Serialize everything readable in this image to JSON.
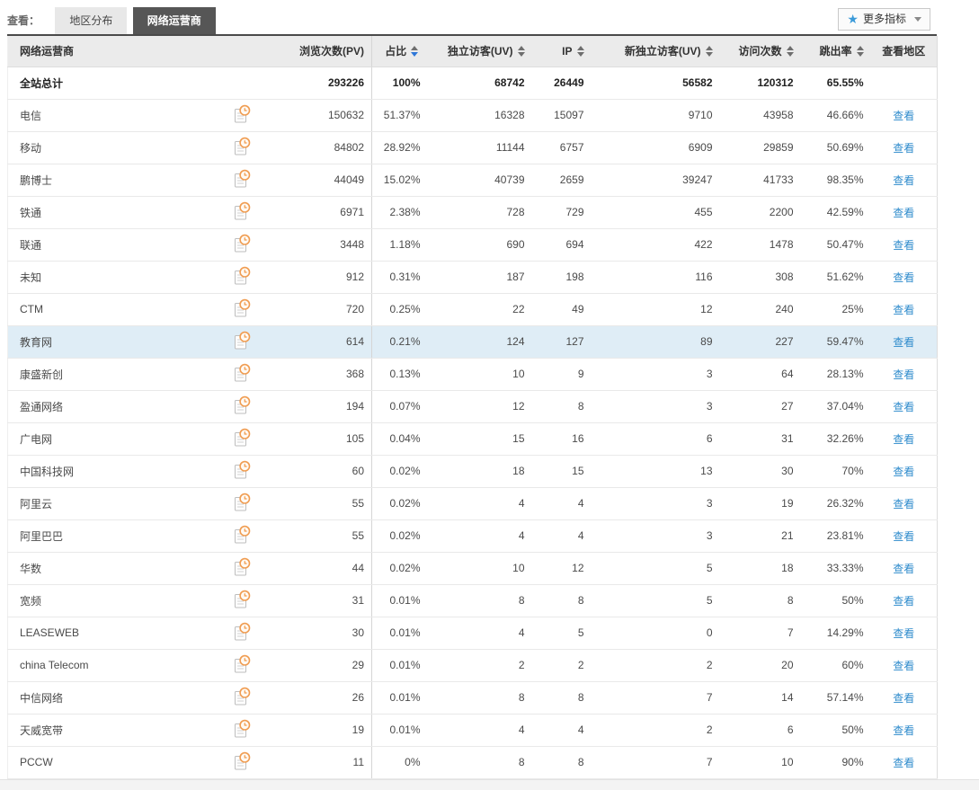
{
  "toolbar": {
    "view_label": "查看：",
    "tabs": [
      {
        "label": "地区分布",
        "active": false
      },
      {
        "label": "网络运营商",
        "active": true
      }
    ],
    "more_metrics": {
      "label": "更多指标",
      "icon": "star-icon",
      "caret_icon": "caret-down-icon"
    }
  },
  "icons": {
    "row_icon": "trend-history-icon",
    "row_icon_color": "#f09d52"
  },
  "colors": {
    "accent_link": "#2e8bcc",
    "active_tab_bg": "#565656",
    "active_sort_arrow": "#2e77d8",
    "highlight_row_bg": "#dfedf6",
    "header_bg": "#ebebeb",
    "star_blue": "#3a9ad9"
  },
  "table": {
    "columns": [
      {
        "key": "name",
        "label": "网络运营商",
        "sortable": false
      },
      {
        "key": "icon",
        "label": "",
        "sortable": false
      },
      {
        "key": "pv",
        "label": "浏览次数(PV)",
        "sortable": false
      },
      {
        "key": "ratio",
        "label": "占比",
        "sortable": true,
        "sort": "desc"
      },
      {
        "key": "uv",
        "label": "独立访客(UV)",
        "sortable": true
      },
      {
        "key": "ip",
        "label": "IP",
        "sortable": true
      },
      {
        "key": "newuv",
        "label": "新独立访客(UV)",
        "sortable": true
      },
      {
        "key": "visits",
        "label": "访问次数",
        "sortable": true
      },
      {
        "key": "bounce",
        "label": "跳出率",
        "sortable": true
      },
      {
        "key": "view",
        "label": "查看地区",
        "sortable": false
      }
    ],
    "view_link_label": "查看",
    "total_row": {
      "name": "全站总计",
      "pv": "293226",
      "ratio": "100%",
      "uv": "68742",
      "ip": "26449",
      "newuv": "56582",
      "visits": "120312",
      "bounce": "65.55%"
    },
    "rows": [
      {
        "name": "电信",
        "pv": "150632",
        "ratio": "51.37%",
        "uv": "16328",
        "ip": "15097",
        "newuv": "9710",
        "visits": "43958",
        "bounce": "46.66%"
      },
      {
        "name": "移动",
        "pv": "84802",
        "ratio": "28.92%",
        "uv": "11144",
        "ip": "6757",
        "newuv": "6909",
        "visits": "29859",
        "bounce": "50.69%"
      },
      {
        "name": "鹏博士",
        "pv": "44049",
        "ratio": "15.02%",
        "uv": "40739",
        "ip": "2659",
        "newuv": "39247",
        "visits": "41733",
        "bounce": "98.35%"
      },
      {
        "name": "铁通",
        "pv": "6971",
        "ratio": "2.38%",
        "uv": "728",
        "ip": "729",
        "newuv": "455",
        "visits": "2200",
        "bounce": "42.59%"
      },
      {
        "name": "联通",
        "pv": "3448",
        "ratio": "1.18%",
        "uv": "690",
        "ip": "694",
        "newuv": "422",
        "visits": "1478",
        "bounce": "50.47%"
      },
      {
        "name": "未知",
        "pv": "912",
        "ratio": "0.31%",
        "uv": "187",
        "ip": "198",
        "newuv": "116",
        "visits": "308",
        "bounce": "51.62%"
      },
      {
        "name": "CTM",
        "pv": "720",
        "ratio": "0.25%",
        "uv": "22",
        "ip": "49",
        "newuv": "12",
        "visits": "240",
        "bounce": "25%"
      },
      {
        "name": "教育网",
        "pv": "614",
        "ratio": "0.21%",
        "uv": "124",
        "ip": "127",
        "newuv": "89",
        "visits": "227",
        "bounce": "59.47%",
        "highlighted": true
      },
      {
        "name": "康盛新创",
        "pv": "368",
        "ratio": "0.13%",
        "uv": "10",
        "ip": "9",
        "newuv": "3",
        "visits": "64",
        "bounce": "28.13%"
      },
      {
        "name": "盈通网络",
        "pv": "194",
        "ratio": "0.07%",
        "uv": "12",
        "ip": "8",
        "newuv": "3",
        "visits": "27",
        "bounce": "37.04%"
      },
      {
        "name": "广电网",
        "pv": "105",
        "ratio": "0.04%",
        "uv": "15",
        "ip": "16",
        "newuv": "6",
        "visits": "31",
        "bounce": "32.26%"
      },
      {
        "name": "中国科技网",
        "pv": "60",
        "ratio": "0.02%",
        "uv": "18",
        "ip": "15",
        "newuv": "13",
        "visits": "30",
        "bounce": "70%"
      },
      {
        "name": "阿里云",
        "pv": "55",
        "ratio": "0.02%",
        "uv": "4",
        "ip": "4",
        "newuv": "3",
        "visits": "19",
        "bounce": "26.32%"
      },
      {
        "name": "阿里巴巴",
        "pv": "55",
        "ratio": "0.02%",
        "uv": "4",
        "ip": "4",
        "newuv": "3",
        "visits": "21",
        "bounce": "23.81%"
      },
      {
        "name": "华数",
        "pv": "44",
        "ratio": "0.02%",
        "uv": "10",
        "ip": "12",
        "newuv": "5",
        "visits": "18",
        "bounce": "33.33%"
      },
      {
        "name": "宽频",
        "pv": "31",
        "ratio": "0.01%",
        "uv": "8",
        "ip": "8",
        "newuv": "5",
        "visits": "8",
        "bounce": "50%"
      },
      {
        "name": "LEASEWEB",
        "pv": "30",
        "ratio": "0.01%",
        "uv": "4",
        "ip": "5",
        "newuv": "0",
        "visits": "7",
        "bounce": "14.29%"
      },
      {
        "name": "china Telecom",
        "pv": "29",
        "ratio": "0.01%",
        "uv": "2",
        "ip": "2",
        "newuv": "2",
        "visits": "20",
        "bounce": "60%"
      },
      {
        "name": "中信网络",
        "pv": "26",
        "ratio": "0.01%",
        "uv": "8",
        "ip": "8",
        "newuv": "7",
        "visits": "14",
        "bounce": "57.14%"
      },
      {
        "name": "天威宽带",
        "pv": "19",
        "ratio": "0.01%",
        "uv": "4",
        "ip": "4",
        "newuv": "2",
        "visits": "6",
        "bounce": "50%"
      },
      {
        "name": "PCCW",
        "pv": "11",
        "ratio": "0%",
        "uv": "8",
        "ip": "8",
        "newuv": "7",
        "visits": "10",
        "bounce": "90%"
      }
    ]
  }
}
